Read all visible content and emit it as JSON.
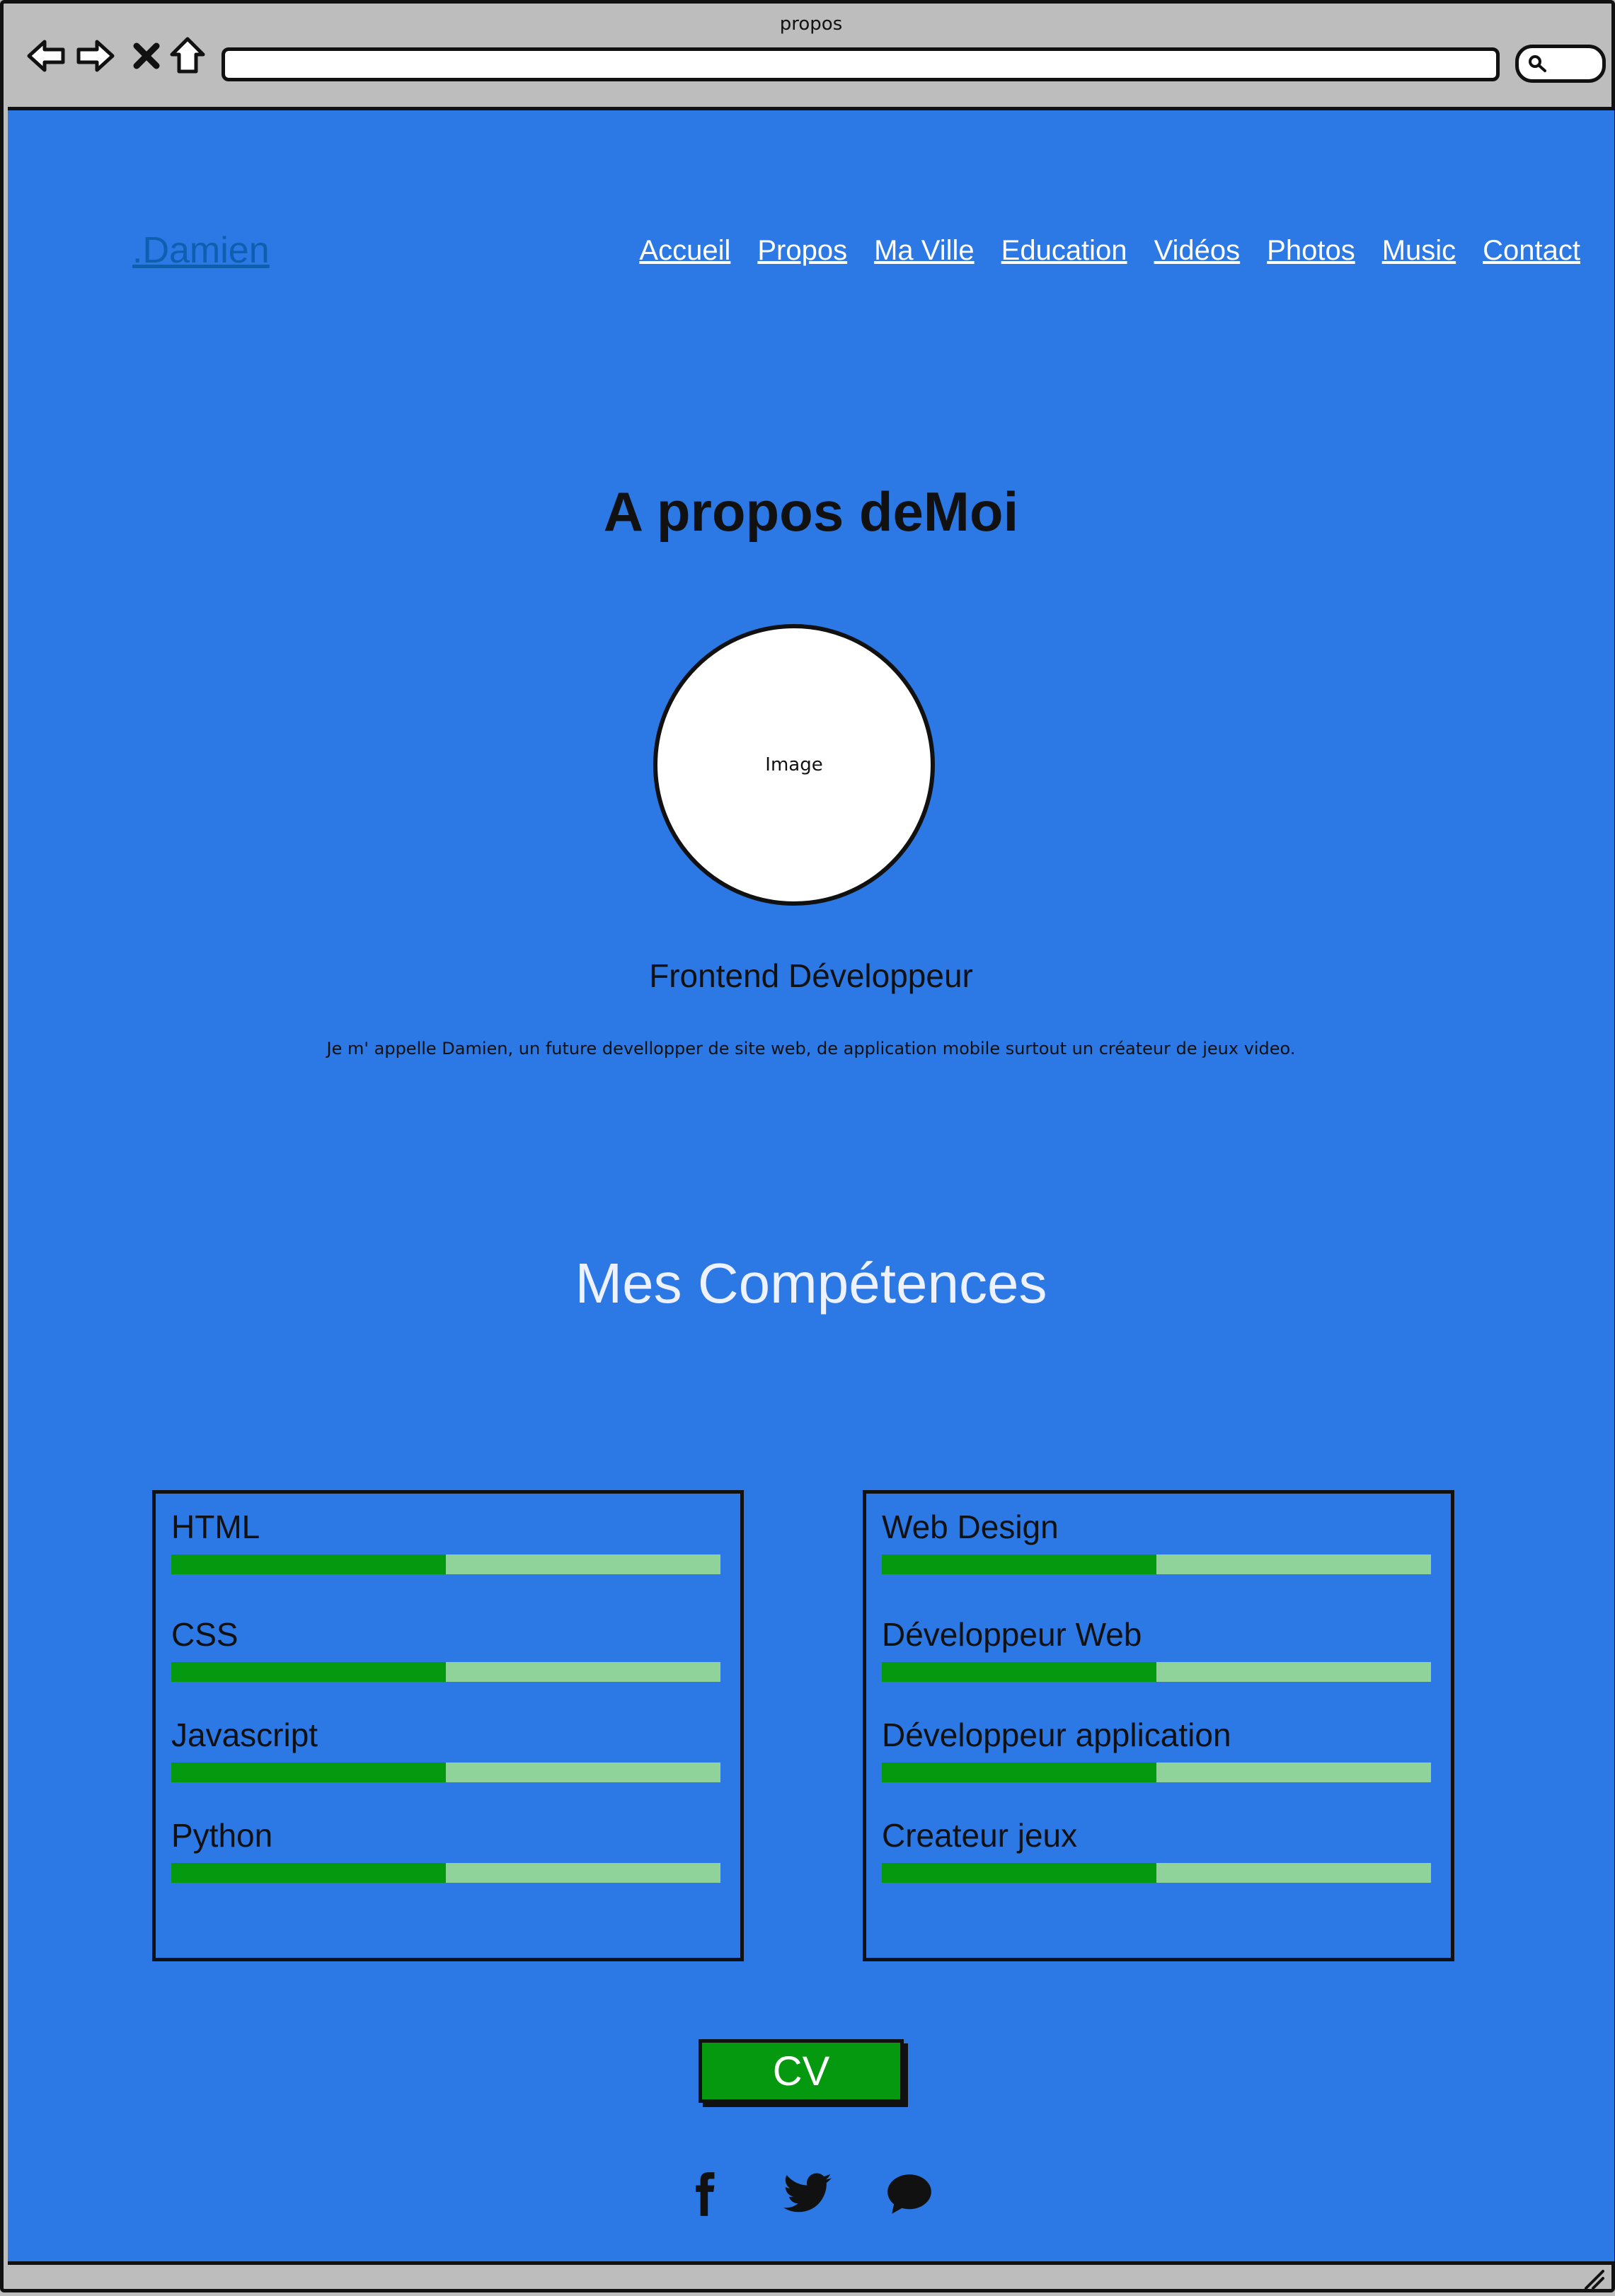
{
  "window": {
    "title": "propos"
  },
  "icons": {
    "back": "back-arrow-icon",
    "forward": "forward-arrow-icon",
    "stop": "close-icon",
    "home": "home-icon",
    "search": "search-icon",
    "resize": "resize-grip-icon",
    "facebook": "facebook-icon",
    "twitter": "twitter-icon",
    "chat": "chat-bubble-icon"
  },
  "colors": {
    "page_bg": "#2c78e4",
    "brand": "#0d5fb0",
    "bar_fill": "#05990f",
    "bar_track": "#8fd39a",
    "cv_button": "#05990f"
  },
  "header": {
    "brand": ".Damien",
    "nav": [
      "Accueil",
      "Propos",
      "Ma Ville",
      "Education",
      "Vidéos",
      "Photos",
      "Music",
      "Contact"
    ]
  },
  "about": {
    "title": "A propos deMoi",
    "image_label": "Image",
    "role": "Frontend Développeur",
    "intro": "Je m' appelle Damien, un future devellopper de site web, de application mobile surtout un créateur de jeux video."
  },
  "skills": {
    "title": "Mes Compétences",
    "left": [
      {
        "label": "HTML",
        "level": 0.5
      },
      {
        "label": "CSS",
        "level": 0.5
      },
      {
        "label": "Javascript",
        "level": 0.5
      },
      {
        "label": "Python",
        "level": 0.5
      }
    ],
    "right": [
      {
        "label": "Web Design",
        "level": 0.5
      },
      {
        "label": "Développeur Web",
        "level": 0.5
      },
      {
        "label": "Développeur application",
        "level": 0.5
      },
      {
        "label": "Createur jeux",
        "level": 0.5
      }
    ]
  },
  "cv_button": "CV"
}
